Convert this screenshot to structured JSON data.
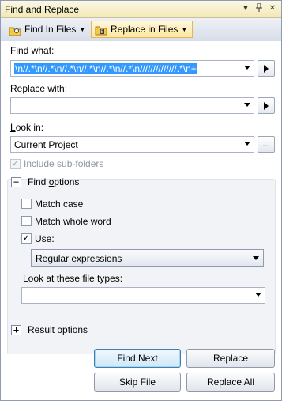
{
  "window": {
    "title": "Find and Replace"
  },
  "toolbar": {
    "find_in_files": "Find In Files",
    "replace_in_files": "Replace in Files"
  },
  "find": {
    "label_prefix": "",
    "label_underline": "F",
    "label_rest": "ind what:",
    "value": "\\n//.*\\n//.*\\n//.*\\n//.*\\n//.*\\n//.*\\n//////////////.*\\n+"
  },
  "replace": {
    "label_prefix": "Re",
    "label_underline": "p",
    "label_rest": "lace with:",
    "value": ""
  },
  "look_in": {
    "label_prefix": "",
    "label_underline": "L",
    "label_rest": "ook in:",
    "value": "Current Project",
    "browse_label": "..."
  },
  "include_subfolders": {
    "label": "Include sub-folders",
    "checked": true,
    "enabled": false
  },
  "find_options": {
    "label_prefix": "Find ",
    "label_underline": "o",
    "label_rest": "ptions",
    "expander": "−",
    "match_case": {
      "label": "Match case",
      "checked": false
    },
    "match_whole_word": {
      "label": "Match whole word",
      "checked": false
    },
    "use": {
      "label": "Use:",
      "checked": true,
      "check_glyph": "✓"
    },
    "use_value": "Regular expressions",
    "file_types_label": "Look at these file types:",
    "file_types_value": ""
  },
  "result_options": {
    "label": "Result options",
    "expander": "+"
  },
  "buttons": {
    "find_next": "Find Next",
    "replace": "Replace",
    "skip_file": "Skip File",
    "replace_all": "Replace All"
  },
  "colors": {
    "title_bg": "#f6edc3",
    "selection": "#3399ff",
    "default_btn_border": "#3c7fb1"
  }
}
